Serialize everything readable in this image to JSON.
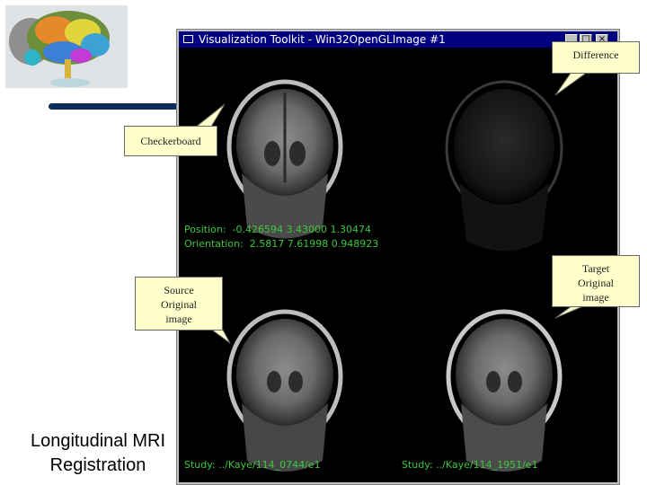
{
  "window": {
    "title": "Visualization Toolkit - Win32OpenGLImage #1",
    "buttons": [
      "_",
      "□",
      "×"
    ]
  },
  "overlay": {
    "position_line": "Position:  -0.426594 3.43000 1.30474",
    "orientation_line": "Orientation:  2.5817 7.61998 0.948923",
    "study_left": "Study: ../Kaye/114_0744/e1",
    "study_right": "Study: ../Kaye/114_1951/e1"
  },
  "callouts": {
    "difference": "Difference",
    "checkerboard": "Checkerboard",
    "source": [
      "Source",
      "Original",
      "image"
    ],
    "target": [
      "Target",
      "Original",
      "image"
    ]
  },
  "slide": {
    "title_line1": "Longitudinal MRI",
    "title_line2": "Registration"
  },
  "icons": {
    "logo": "brain-logo-icon"
  }
}
